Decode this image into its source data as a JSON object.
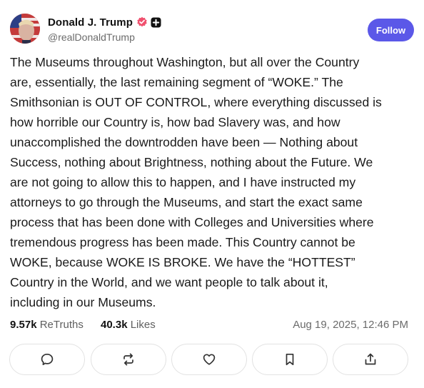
{
  "post": {
    "author": {
      "display_name": "Donald J. Trump",
      "handle": "@realDonaldTrump",
      "verified": true,
      "verified_color": "#f0506e"
    },
    "follow_label": "Follow",
    "accent_color": "#5b58e8",
    "text_lines": [
      "The Museums throughout Washington, but all over the Country",
      "are, essentially, the last remaining segment of “WOKE.” The",
      "Smithsonian is OUT OF CONTROL, where everything discussed is",
      "how horrible our Country is, how bad Slavery was, and how",
      "unaccomplished the downtrodden have been — Nothing about",
      "Success, nothing about Brightness, nothing about the Future. We",
      "are not going to allow this to happen, and I have instructed my",
      "attorneys to go through the Museums, and start the exact same",
      "process that has been done with Colleges and Universities where",
      "tremendous progress has been made. This Country cannot be",
      "WOKE, because WOKE IS BROKE. We have the “HOTTEST”",
      "Country in the World, and we want people to talk about it,",
      "including in our Museums."
    ],
    "stats": {
      "retruths_count": "9.57k",
      "retruths_label": "ReTruths",
      "likes_count": "40.3k",
      "likes_label": "Likes"
    },
    "timestamp": "Aug 19, 2025, 12:46 PM",
    "actions": [
      {
        "icon": "reply-icon"
      },
      {
        "icon": "retruth-icon"
      },
      {
        "icon": "like-icon"
      },
      {
        "icon": "bookmark-icon"
      },
      {
        "icon": "share-icon"
      }
    ]
  }
}
